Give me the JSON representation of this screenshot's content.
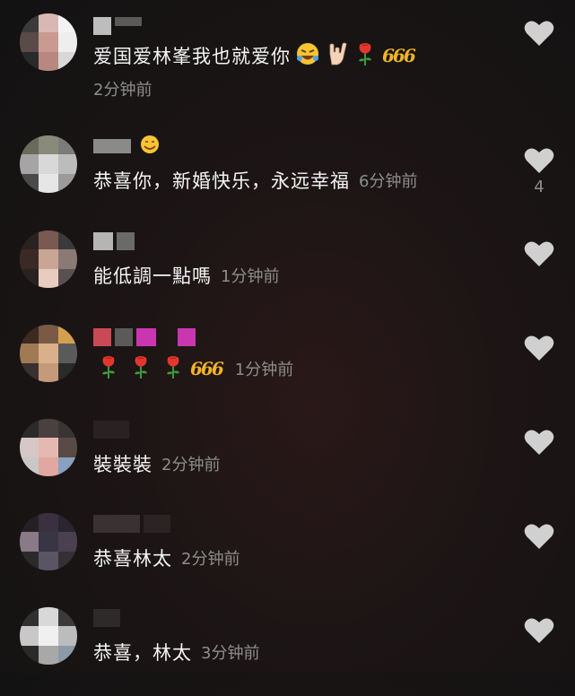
{
  "comments": [
    {
      "text": "爱国爱林峯我也就爱你",
      "emojis": [
        "rolling-laughing-emoji",
        "love-you-hand-emoji",
        "rose-emoji",
        "666-emoji"
      ],
      "time": "2分钟前"
    },
    {
      "text": "恭喜你，新婚快乐，永远幸福",
      "emojis": [],
      "time": "6分钟前",
      "like_count": "4"
    },
    {
      "text": "能低調一點嗎",
      "emojis": [],
      "time": "1分钟前"
    },
    {
      "text": "",
      "emojis": [
        "rose-emoji",
        "rose-emoji",
        "rose-emoji",
        "666-emoji"
      ],
      "time": "1分钟前"
    },
    {
      "text": "裝裝裝",
      "emojis": [],
      "time": "2分钟前"
    },
    {
      "text": "恭喜林太",
      "emojis": [],
      "time": "2分钟前"
    },
    {
      "text": "恭喜，林太",
      "emojis": [],
      "time": "3分钟前"
    }
  ],
  "emoji_666": "666",
  "colors": {
    "background": "#1d1515",
    "text": "#f4f4f4",
    "time": "#8d8d8d",
    "heart": "#d0d0d0",
    "gold": "#f0b426"
  }
}
